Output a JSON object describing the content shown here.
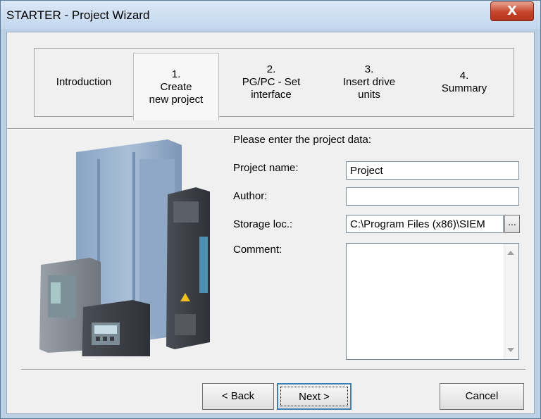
{
  "window": {
    "title": "STARTER - Project Wizard",
    "close_glyph": "X"
  },
  "steps": [
    {
      "number": "",
      "line1": "Introduction",
      "line2": ""
    },
    {
      "number": "1.",
      "line1": "Create",
      "line2": "new project"
    },
    {
      "number": "2.",
      "line1": "PG/PC - Set",
      "line2": "interface"
    },
    {
      "number": "3.",
      "line1": "Insert drive",
      "line2": "units"
    },
    {
      "number": "4.",
      "line1": "Summary",
      "line2": ""
    }
  ],
  "form": {
    "prompt": "Please enter the project data:",
    "project_name_label": "Project name:",
    "project_name_value": "Project",
    "author_label": "Author:",
    "author_value": "",
    "storage_label": "Storage loc.:",
    "storage_value": "C:\\Program Files (x86)\\SIEM",
    "browse_label": "...",
    "comment_label": "Comment:",
    "comment_value": ""
  },
  "buttons": {
    "back": "< Back",
    "next": "Next >",
    "cancel": "Cancel"
  },
  "colors": {
    "title_bar": "#c3d7ee",
    "close_button": "#c4442c",
    "dialog_bg": "#f0f0f0",
    "default_button_border": "#3c7fb1"
  }
}
